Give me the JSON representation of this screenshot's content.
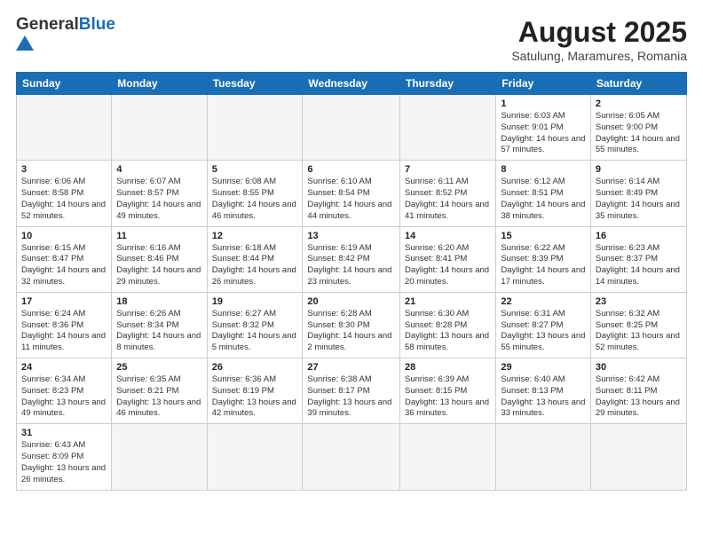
{
  "header": {
    "logo_general": "General",
    "logo_blue": "Blue",
    "title": "August 2025",
    "subtitle": "Satulung, Maramures, Romania"
  },
  "weekdays": [
    "Sunday",
    "Monday",
    "Tuesday",
    "Wednesday",
    "Thursday",
    "Friday",
    "Saturday"
  ],
  "weeks": [
    [
      {
        "day": "",
        "info": ""
      },
      {
        "day": "",
        "info": ""
      },
      {
        "day": "",
        "info": ""
      },
      {
        "day": "",
        "info": ""
      },
      {
        "day": "",
        "info": ""
      },
      {
        "day": "1",
        "info": "Sunrise: 6:03 AM\nSunset: 9:01 PM\nDaylight: 14 hours and 57 minutes."
      },
      {
        "day": "2",
        "info": "Sunrise: 6:05 AM\nSunset: 9:00 PM\nDaylight: 14 hours and 55 minutes."
      }
    ],
    [
      {
        "day": "3",
        "info": "Sunrise: 6:06 AM\nSunset: 8:58 PM\nDaylight: 14 hours and 52 minutes."
      },
      {
        "day": "4",
        "info": "Sunrise: 6:07 AM\nSunset: 8:57 PM\nDaylight: 14 hours and 49 minutes."
      },
      {
        "day": "5",
        "info": "Sunrise: 6:08 AM\nSunset: 8:55 PM\nDaylight: 14 hours and 46 minutes."
      },
      {
        "day": "6",
        "info": "Sunrise: 6:10 AM\nSunset: 8:54 PM\nDaylight: 14 hours and 44 minutes."
      },
      {
        "day": "7",
        "info": "Sunrise: 6:11 AM\nSunset: 8:52 PM\nDaylight: 14 hours and 41 minutes."
      },
      {
        "day": "8",
        "info": "Sunrise: 6:12 AM\nSunset: 8:51 PM\nDaylight: 14 hours and 38 minutes."
      },
      {
        "day": "9",
        "info": "Sunrise: 6:14 AM\nSunset: 8:49 PM\nDaylight: 14 hours and 35 minutes."
      }
    ],
    [
      {
        "day": "10",
        "info": "Sunrise: 6:15 AM\nSunset: 8:47 PM\nDaylight: 14 hours and 32 minutes."
      },
      {
        "day": "11",
        "info": "Sunrise: 6:16 AM\nSunset: 8:46 PM\nDaylight: 14 hours and 29 minutes."
      },
      {
        "day": "12",
        "info": "Sunrise: 6:18 AM\nSunset: 8:44 PM\nDaylight: 14 hours and 26 minutes."
      },
      {
        "day": "13",
        "info": "Sunrise: 6:19 AM\nSunset: 8:42 PM\nDaylight: 14 hours and 23 minutes."
      },
      {
        "day": "14",
        "info": "Sunrise: 6:20 AM\nSunset: 8:41 PM\nDaylight: 14 hours and 20 minutes."
      },
      {
        "day": "15",
        "info": "Sunrise: 6:22 AM\nSunset: 8:39 PM\nDaylight: 14 hours and 17 minutes."
      },
      {
        "day": "16",
        "info": "Sunrise: 6:23 AM\nSunset: 8:37 PM\nDaylight: 14 hours and 14 minutes."
      }
    ],
    [
      {
        "day": "17",
        "info": "Sunrise: 6:24 AM\nSunset: 8:36 PM\nDaylight: 14 hours and 11 minutes."
      },
      {
        "day": "18",
        "info": "Sunrise: 6:26 AM\nSunset: 8:34 PM\nDaylight: 14 hours and 8 minutes."
      },
      {
        "day": "19",
        "info": "Sunrise: 6:27 AM\nSunset: 8:32 PM\nDaylight: 14 hours and 5 minutes."
      },
      {
        "day": "20",
        "info": "Sunrise: 6:28 AM\nSunset: 8:30 PM\nDaylight: 14 hours and 2 minutes."
      },
      {
        "day": "21",
        "info": "Sunrise: 6:30 AM\nSunset: 8:28 PM\nDaylight: 13 hours and 58 minutes."
      },
      {
        "day": "22",
        "info": "Sunrise: 6:31 AM\nSunset: 8:27 PM\nDaylight: 13 hours and 55 minutes."
      },
      {
        "day": "23",
        "info": "Sunrise: 6:32 AM\nSunset: 8:25 PM\nDaylight: 13 hours and 52 minutes."
      }
    ],
    [
      {
        "day": "24",
        "info": "Sunrise: 6:34 AM\nSunset: 8:23 PM\nDaylight: 13 hours and 49 minutes."
      },
      {
        "day": "25",
        "info": "Sunrise: 6:35 AM\nSunset: 8:21 PM\nDaylight: 13 hours and 46 minutes."
      },
      {
        "day": "26",
        "info": "Sunrise: 6:36 AM\nSunset: 8:19 PM\nDaylight: 13 hours and 42 minutes."
      },
      {
        "day": "27",
        "info": "Sunrise: 6:38 AM\nSunset: 8:17 PM\nDaylight: 13 hours and 39 minutes."
      },
      {
        "day": "28",
        "info": "Sunrise: 6:39 AM\nSunset: 8:15 PM\nDaylight: 13 hours and 36 minutes."
      },
      {
        "day": "29",
        "info": "Sunrise: 6:40 AM\nSunset: 8:13 PM\nDaylight: 13 hours and 33 minutes."
      },
      {
        "day": "30",
        "info": "Sunrise: 6:42 AM\nSunset: 8:11 PM\nDaylight: 13 hours and 29 minutes."
      }
    ],
    [
      {
        "day": "31",
        "info": "Sunrise: 6:43 AM\nSunset: 8:09 PM\nDaylight: 13 hours and 26 minutes."
      },
      {
        "day": "",
        "info": ""
      },
      {
        "day": "",
        "info": ""
      },
      {
        "day": "",
        "info": ""
      },
      {
        "day": "",
        "info": ""
      },
      {
        "day": "",
        "info": ""
      },
      {
        "day": "",
        "info": ""
      }
    ]
  ]
}
